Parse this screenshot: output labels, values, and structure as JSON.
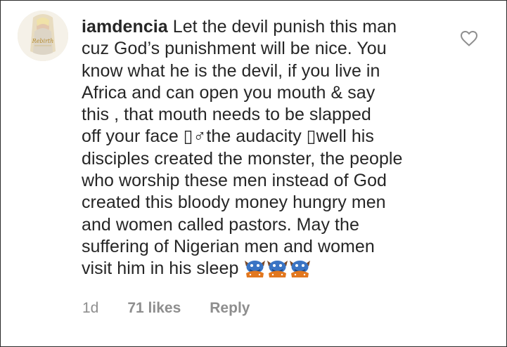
{
  "comment": {
    "username": "iamdencia",
    "lines": [
      "Let the devil punish this man",
      "cuz God’s punishment will be nice. You",
      "know what he is the devil, if you live in",
      "Africa and can open you mouth & say",
      "this , that mouth needs to be slapped",
      "off your face ▯♂the audacity ▯well his",
      "disciples created the monster, the people",
      "who worship these men instead of God",
      "created this bloody money hungry men",
      "and women called pastors. May the",
      "suffering of Nigerian men and women",
      "visit him in his sleep"
    ],
    "emoji_icons": [
      "ogre-emoji-icon",
      "ogre-emoji-icon",
      "ogre-emoji-icon"
    ],
    "avatar_text": "Rebirth"
  },
  "meta": {
    "time": "1d",
    "likes": "71 likes",
    "reply": "Reply"
  },
  "icons": {
    "like": "heart-outline-icon"
  },
  "colors": {
    "text": "#262626",
    "meta": "#8e8e8e",
    "emoji": "#3a74c4"
  }
}
